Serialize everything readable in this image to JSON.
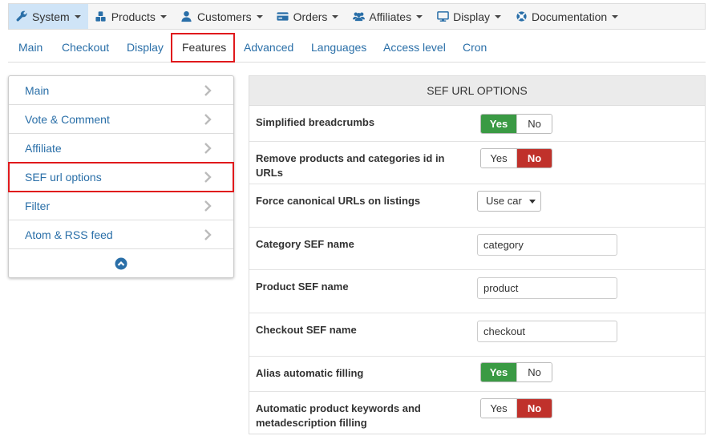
{
  "topmenu": {
    "items": [
      {
        "label": "System",
        "icon": "wrench-icon"
      },
      {
        "label": "Products",
        "icon": "cubes-icon"
      },
      {
        "label": "Customers",
        "icon": "user-icon"
      },
      {
        "label": "Orders",
        "icon": "credit-card-icon"
      },
      {
        "label": "Affiliates",
        "icon": "users-icon"
      },
      {
        "label": "Display",
        "icon": "monitor-icon"
      },
      {
        "label": "Documentation",
        "icon": "life-ring-icon"
      }
    ],
    "active_index": 0
  },
  "subtabs": {
    "items": [
      "Main",
      "Checkout",
      "Display",
      "Features",
      "Advanced",
      "Languages",
      "Access level",
      "Cron"
    ],
    "active_index": 3
  },
  "sidemenu": {
    "items": [
      "Main",
      "Vote & Comment",
      "Affiliate",
      "SEF url options",
      "Filter",
      "Atom & RSS feed"
    ],
    "active_index": 3
  },
  "options": {
    "title": "SEF URL OPTIONS",
    "rows": [
      {
        "label": "Simplified breadcrumbs",
        "type": "toggle",
        "value": "Yes"
      },
      {
        "label": "Remove products and categories id in URLs",
        "type": "toggle",
        "value": "No"
      },
      {
        "label": "Force canonical URLs on listings",
        "type": "select",
        "value": "Use car"
      },
      {
        "label": "Category SEF name",
        "type": "text",
        "value": "category"
      },
      {
        "label": "Product SEF name",
        "type": "text",
        "value": "product"
      },
      {
        "label": "Checkout SEF name",
        "type": "text",
        "value": "checkout"
      },
      {
        "label": "Alias automatic filling",
        "type": "toggle",
        "value": "Yes"
      },
      {
        "label": "Automatic product keywords and metadescription filling",
        "type": "toggle",
        "value": "No"
      }
    ],
    "yes_label": "Yes",
    "no_label": "No"
  },
  "colors": {
    "accent_blue": "#2a6fa8",
    "yes_green": "#3a9a44",
    "no_red": "#c0312b",
    "highlight_red": "#e0191c",
    "active_menu_bg": "#cfe4f7"
  }
}
